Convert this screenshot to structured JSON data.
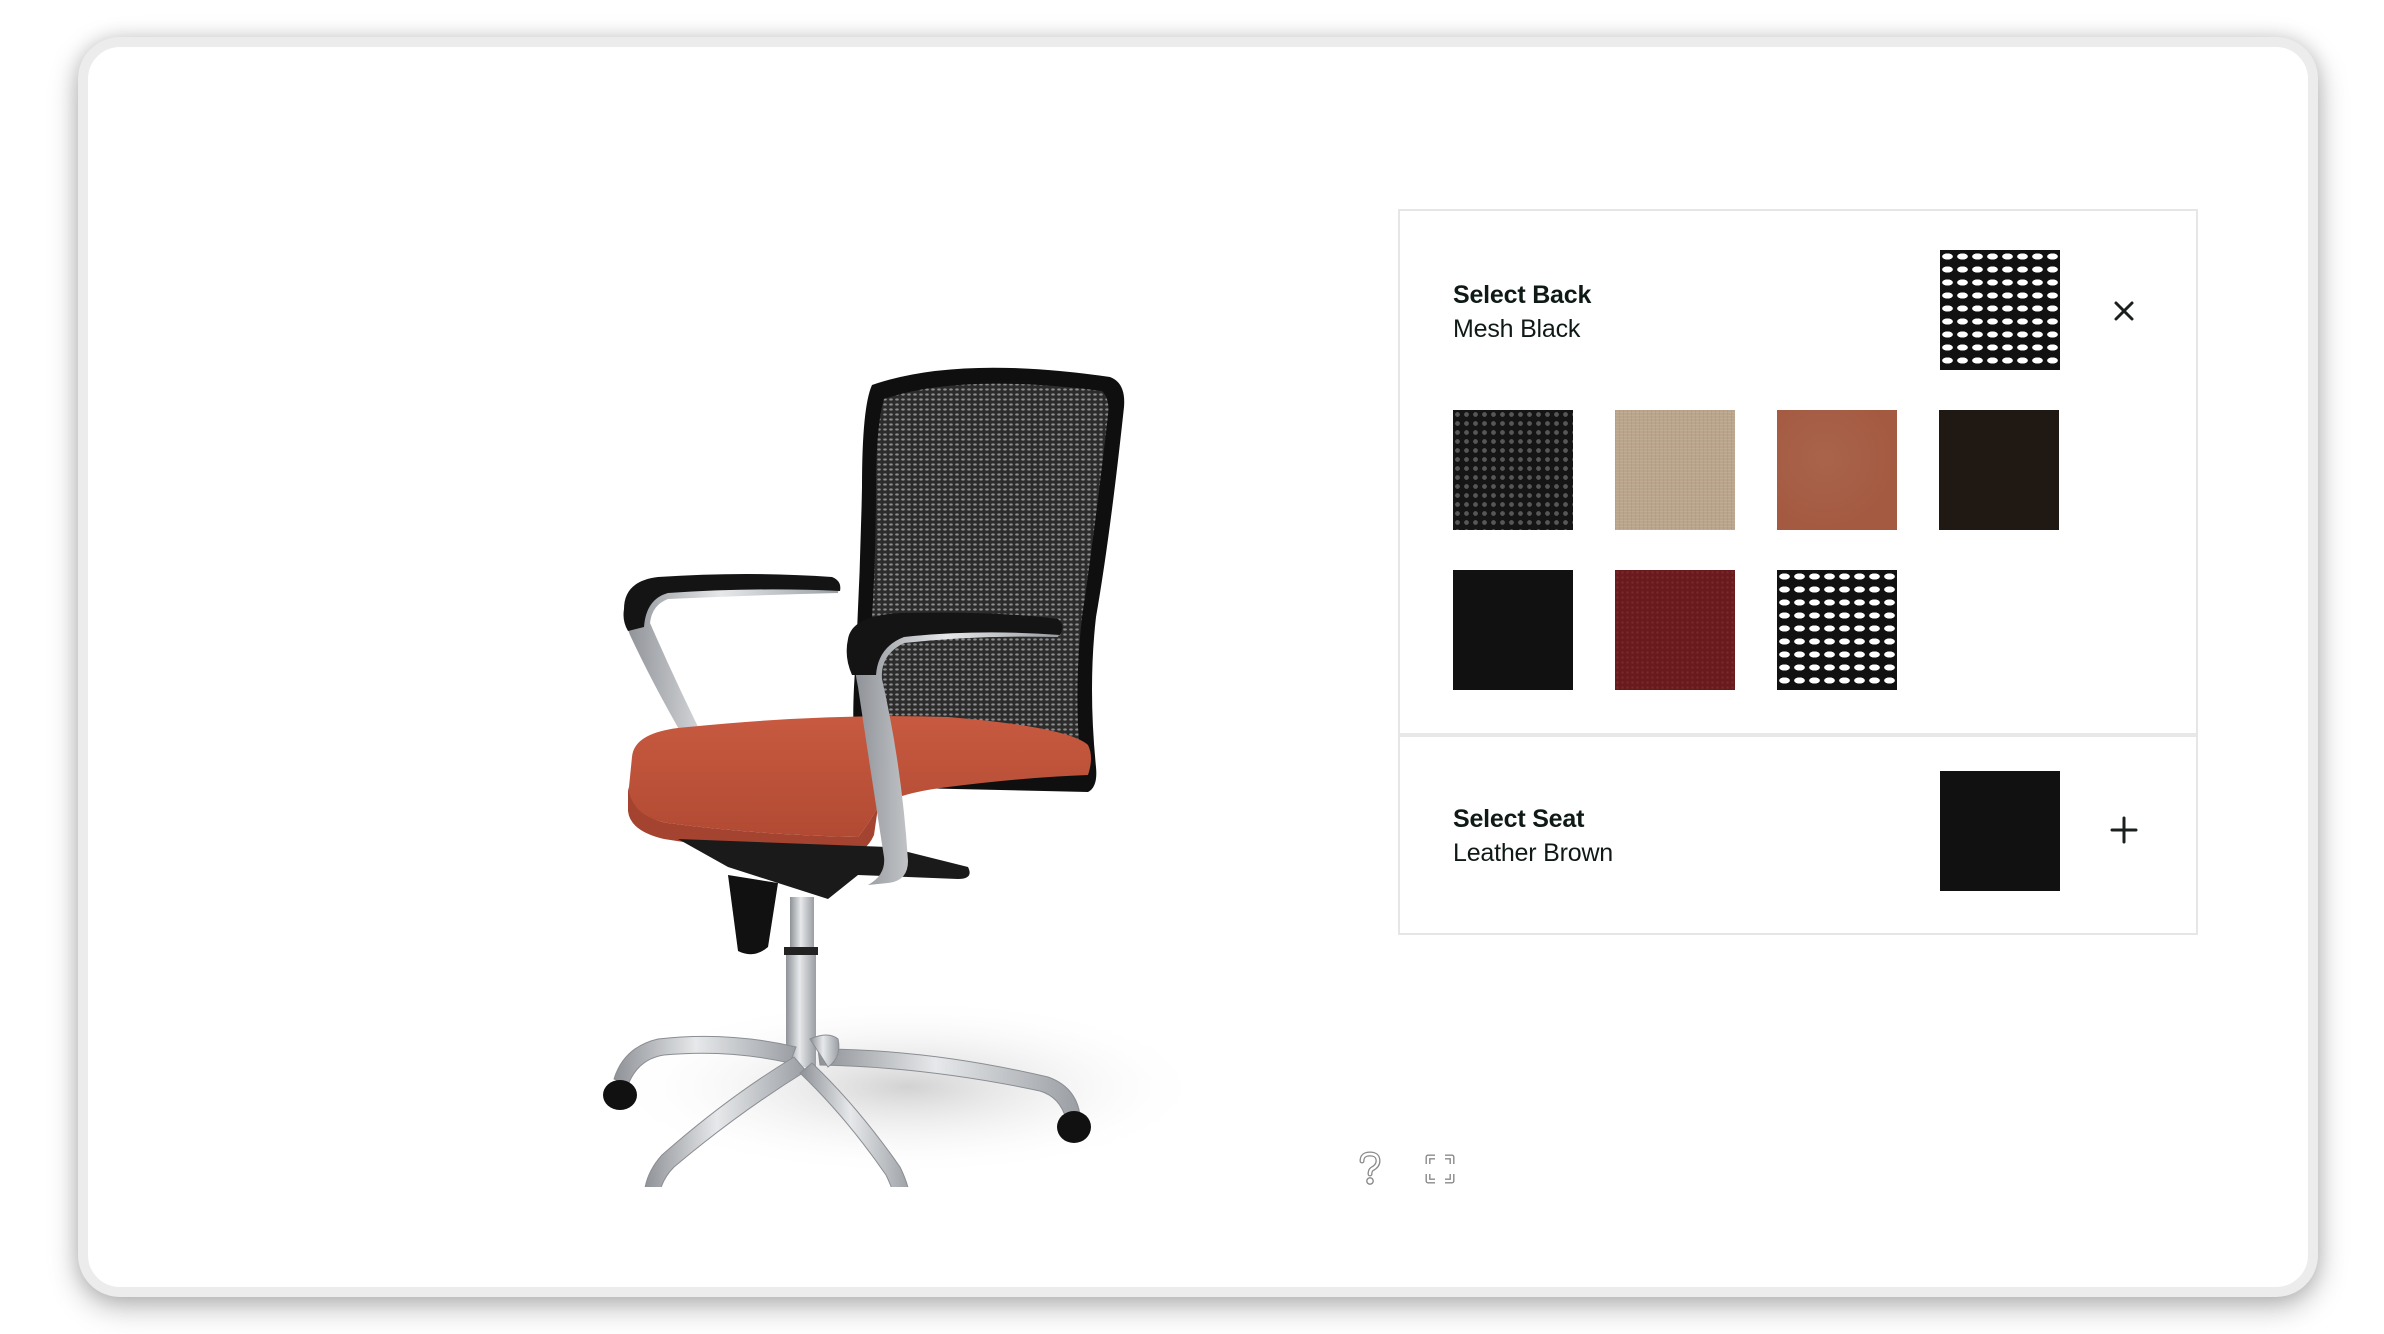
{
  "viewer": {
    "product": "office-chair-mesh-back",
    "controls": [
      {
        "name": "help",
        "icon": "question-mark-icon"
      },
      {
        "name": "fullscreen",
        "icon": "fullscreen-icon"
      }
    ],
    "chair_colors": {
      "back_mesh": "#3a3a3a",
      "back_frame": "#111111",
      "seat": "#c9573d",
      "metal": "#b9bcbf",
      "casters": "#111111"
    }
  },
  "options": {
    "back": {
      "title": "Select Back",
      "value": "Mesh Black",
      "expanded": true,
      "toggle_icon": "close-icon",
      "current_swatch": {
        "name": "Mesh Black",
        "texture": "mesh",
        "color": "#111111"
      },
      "swatches": [
        {
          "name": "Black Pattern",
          "texture": "dots",
          "color": "#1a1a1a"
        },
        {
          "name": "Linen Beige",
          "texture": "linen",
          "color": "#baa58c"
        },
        {
          "name": "Leather Rust",
          "texture": "leather",
          "color": "#a45a41"
        },
        {
          "name": "Dark Brown",
          "texture": "solid",
          "color": "#1f1813"
        },
        {
          "name": "Black",
          "texture": "solid",
          "color": "#111111"
        },
        {
          "name": "Maroon",
          "texture": "weave",
          "color": "#6a1a1c"
        },
        {
          "name": "Mesh Black",
          "texture": "mesh",
          "color": "#111111"
        }
      ]
    },
    "seat": {
      "title": "Select Seat",
      "value": "Leather Brown",
      "expanded": false,
      "toggle_icon": "plus-icon",
      "current_swatch": {
        "name": "Black",
        "texture": "solid",
        "color": "#111111"
      }
    }
  }
}
